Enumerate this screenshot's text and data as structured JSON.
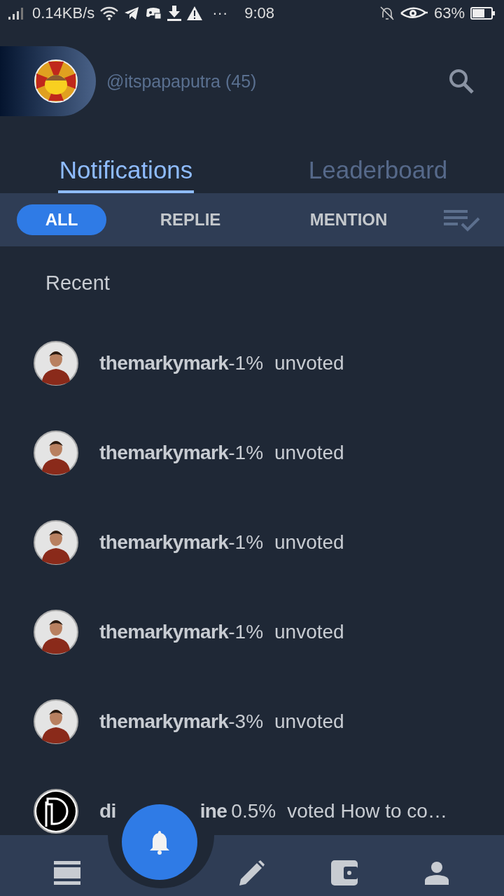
{
  "status_bar": {
    "speed": "0.14KB/s",
    "more": "···",
    "time": "9:08",
    "battery": "63%"
  },
  "header": {
    "handle": "@itspapaputra (45)"
  },
  "tabs": [
    {
      "label": "Notifications",
      "selected": true
    },
    {
      "label": "Leaderboard",
      "selected": false
    }
  ],
  "filters": [
    {
      "label": "ALL",
      "selected": true
    },
    {
      "label": "REPLIE",
      "selected": false
    },
    {
      "label": "MENTION",
      "selected": false
    }
  ],
  "section": "Recent",
  "notifications": [
    {
      "kind": "person",
      "user": "themarkymark",
      "amount": "-1%",
      "action": "unvoted"
    },
    {
      "kind": "person",
      "user": "themarkymark",
      "amount": "-1%",
      "action": "unvoted"
    },
    {
      "kind": "person",
      "user": "themarkymark",
      "amount": "-1%",
      "action": "unvoted"
    },
    {
      "kind": "person",
      "user": "themarkymark",
      "amount": "-1%",
      "action": "unvoted"
    },
    {
      "kind": "person",
      "user": "themarkymark",
      "amount": "-3%",
      "action": "unvoted"
    },
    {
      "kind": "logo",
      "user": "di",
      "user_after_cover": "ine",
      "amount": "0.5%",
      "action": "voted How to co…"
    }
  ],
  "bottom_nav": [
    {
      "kind": "feed",
      "selected": false
    },
    {
      "kind": "bell",
      "selected": true
    },
    {
      "kind": "pencil",
      "selected": false
    },
    {
      "kind": "wallet",
      "selected": false
    },
    {
      "kind": "profile",
      "selected": false
    }
  ]
}
